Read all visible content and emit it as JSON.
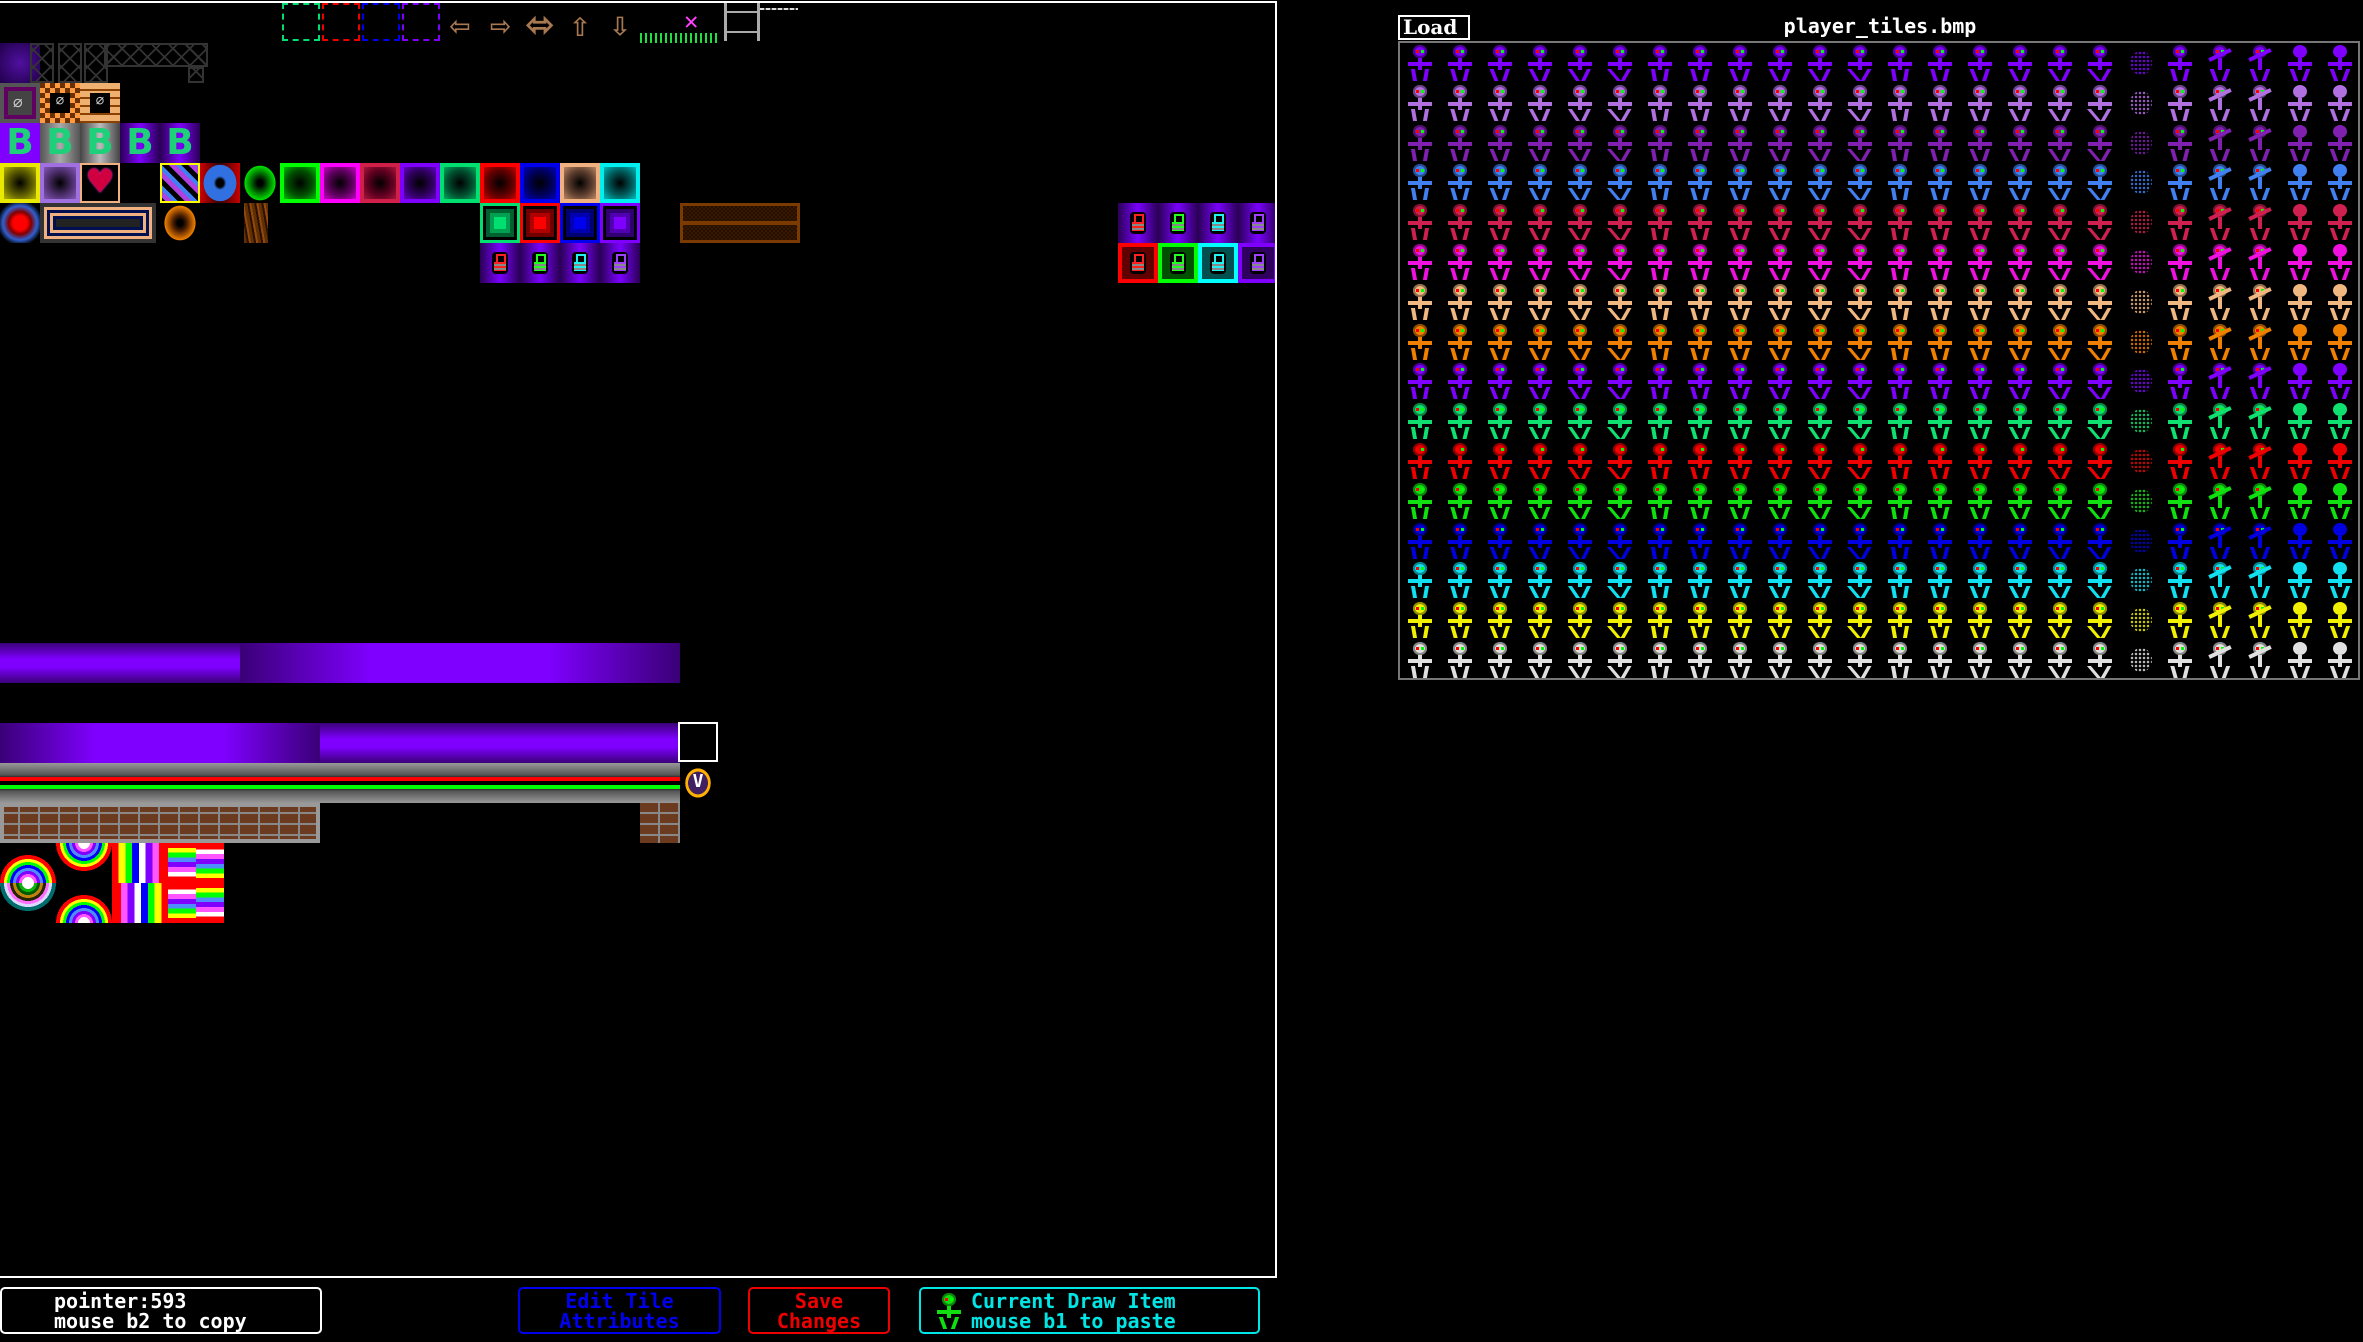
{
  "tile_panel": {
    "dashed_frames": [
      "#00e070",
      "#ee0000",
      "#0000ee",
      "#7f00ff"
    ],
    "arrows": [
      "arrow-left-icon",
      "arrow-right-icon",
      "arrow-left-right-icon",
      "arrow-up-icon",
      "arrow-down-icon"
    ],
    "arrow_glyphs": [
      "⇦",
      "⇨",
      "⬄",
      "⇧",
      "⇩"
    ],
    "b_tiles": [
      "B",
      "B",
      "B",
      "B",
      "B"
    ],
    "colored_squares": [
      {
        "c": "#e8e800",
        "c2": "#606000"
      },
      {
        "c": "#a070e0",
        "c2": "#503070"
      },
      {
        "c": "#ff60a0",
        "c2": "#c00030",
        "special": "heart"
      },
      {
        "c": "#00ff00",
        "c2": "#005000"
      },
      {
        "c": "#ff00ff",
        "c2": "#600060"
      },
      {
        "c": "#d0204a",
        "c2": "#600020"
      },
      {
        "c": "#7f00ff",
        "c2": "#300060"
      },
      {
        "c": "#00e070",
        "c2": "#005030"
      },
      {
        "c": "#ff0000",
        "c2": "#600000"
      },
      {
        "c": "#0000ee",
        "c2": "#000060"
      },
      {
        "c": "#f0b080",
        "c2": "#604030"
      },
      {
        "c": "#00f0f0",
        "c2": "#006060"
      }
    ],
    "gem_frames": [
      {
        "c": "#00e070",
        "c2": "#006030",
        "c3": "#00a050"
      },
      {
        "c": "#ff0000",
        "c2": "#700000",
        "c3": "#b00000"
      },
      {
        "c": "#0000ee",
        "c2": "#000070",
        "c3": "#0000b0"
      },
      {
        "c": "#7f00ff",
        "c2": "#300070",
        "c3": "#5000b0"
      }
    ],
    "locks": [
      "#ff2020",
      "#20ff20",
      "#20f0f0",
      "#a040ff"
    ],
    "lock_boxes": [
      {
        "lc": "#ff2020",
        "c": "#ff0000",
        "box": "#600000"
      },
      {
        "lc": "#20ff20",
        "c": "#00ff00",
        "box": "#005000"
      },
      {
        "lc": "#20f0f0",
        "c": "#00ffff",
        "box": "#005050"
      },
      {
        "lc": "#a040ff",
        "c": "#7f00ff",
        "box": "#300060"
      }
    ]
  },
  "player_panel": {
    "load_label": "Load",
    "file_name": "player_tiles.bmp",
    "walk_poses": 18,
    "special_poses": [
      "particles",
      "walk",
      "arms-up",
      "arms-up",
      "solid",
      "solid"
    ],
    "row_colors": [
      "#7f00ff",
      "#b070e0",
      "#8020b0",
      "#4080f0",
      "#d02050",
      "#f010e0",
      "#f0b880",
      "#f08000",
      "#7f00ff",
      "#10e070",
      "#ee0000",
      "#10e010",
      "#0000e0",
      "#10e0f0",
      "#f0f000",
      "#e0e0e0"
    ]
  },
  "bottom_bar": {
    "pointer_line1": "pointer:593",
    "pointer_line2": "mouse b2 to copy",
    "edit_line1": "Edit Tile",
    "edit_line2": "Attributes",
    "save_line1": "Save",
    "save_line2": "Changes",
    "current_line1": "Current Draw Item",
    "current_line2": "mouse b1 to paste",
    "current_item_color": "#10e010"
  }
}
